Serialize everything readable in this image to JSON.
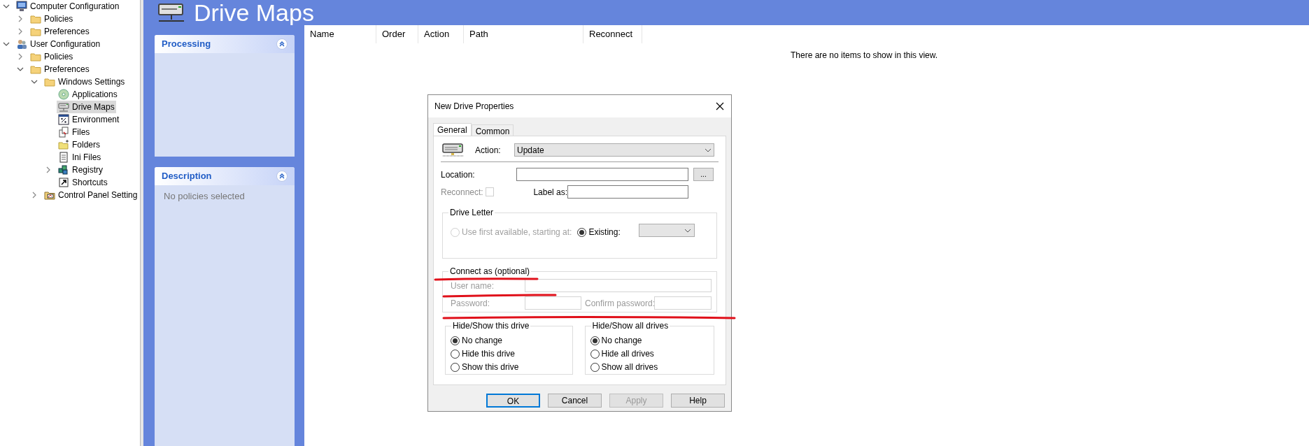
{
  "tree": [
    {
      "label": "Computer Configuration",
      "kind": "computer",
      "expanded": true,
      "selected": false,
      "children": [
        {
          "label": "Policies",
          "kind": "folder",
          "expanded": false,
          "selected": false
        },
        {
          "label": "Preferences",
          "kind": "folder",
          "expanded": false,
          "selected": false
        }
      ]
    },
    {
      "label": "User Configuration",
      "kind": "user",
      "expanded": true,
      "selected": false,
      "children": [
        {
          "label": "Policies",
          "kind": "folder",
          "expanded": false,
          "selected": false
        },
        {
          "label": "Preferences",
          "kind": "folder",
          "expanded": true,
          "selected": false,
          "children": [
            {
              "label": "Windows Settings",
              "kind": "folder",
              "expanded": true,
              "selected": false,
              "children": [
                {
                  "label": "Applications",
                  "kind": "applications",
                  "selected": false
                },
                {
                  "label": "Drive Maps",
                  "kind": "drive",
                  "selected": true
                },
                {
                  "label": "Environment",
                  "kind": "environment",
                  "selected": false
                },
                {
                  "label": "Files",
                  "kind": "files",
                  "selected": false
                },
                {
                  "label": "Folders",
                  "kind": "folders",
                  "selected": false
                },
                {
                  "label": "Ini Files",
                  "kind": "ini",
                  "selected": false
                },
                {
                  "label": "Registry",
                  "kind": "registry",
                  "expanded": false,
                  "selected": false
                },
                {
                  "label": "Shortcuts",
                  "kind": "shortcut",
                  "selected": false
                }
              ]
            },
            {
              "label": "Control Panel Setting",
              "kind": "control-panel",
              "expanded": false,
              "selected": false
            }
          ]
        }
      ]
    }
  ],
  "header": {
    "title": "Drive Maps"
  },
  "panels": [
    {
      "title": "Processing"
    },
    {
      "title": "Description",
      "text": "No policies selected"
    }
  ],
  "table": {
    "columns": [
      "Name",
      "Order",
      "Action",
      "Path",
      "Reconnect"
    ],
    "empty_message": "There are no items to show in this view."
  },
  "dialog": {
    "title": "New Drive Properties",
    "tabs": [
      {
        "label": "General",
        "selected": true
      },
      {
        "label": "Common",
        "selected": false
      }
    ],
    "action": {
      "label": "Action:",
      "value": "Update"
    },
    "location": {
      "label": "Location:",
      "browse": "..."
    },
    "reconnect": {
      "label": "Reconnect:",
      "checked": false,
      "disabled": true
    },
    "label_as": {
      "label": "Label as:"
    },
    "drive_letter": {
      "title": "Drive Letter",
      "options": [
        {
          "label": "Use first available, starting at:",
          "selected": false,
          "disabled": true
        },
        {
          "label": "Existing:",
          "selected": true,
          "disabled": false
        }
      ]
    },
    "connect_as": {
      "title": "Connect as (optional)",
      "disabled": true,
      "user_name": "User name:",
      "password": "Password:",
      "confirm_password": "Confirm password:"
    },
    "hide_show_this": {
      "title": "Hide/Show this drive",
      "options": [
        {
          "label": "No change",
          "selected": true
        },
        {
          "label": "Hide this drive",
          "selected": false
        },
        {
          "label": "Show this drive",
          "selected": false
        }
      ]
    },
    "hide_show_all": {
      "title": "Hide/Show all drives",
      "options": [
        {
          "label": "No change",
          "selected": true
        },
        {
          "label": "Hide all drives",
          "selected": false
        },
        {
          "label": "Show all drives",
          "selected": false
        }
      ]
    },
    "buttons": [
      {
        "label": "OK",
        "default": true,
        "disabled": false
      },
      {
        "label": "Cancel",
        "default": false,
        "disabled": false
      },
      {
        "label": "Apply",
        "default": false,
        "disabled": true
      },
      {
        "label": "Help",
        "default": false,
        "disabled": false
      }
    ]
  }
}
